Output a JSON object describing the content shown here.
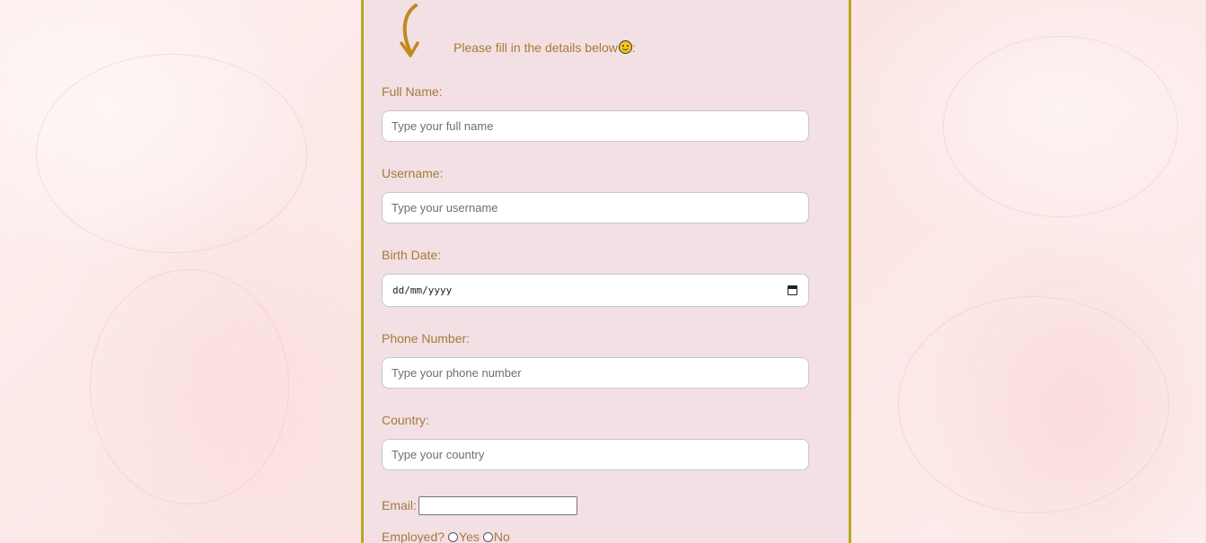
{
  "form": {
    "intro": "Please fill in the details below",
    "intro_suffix": ":",
    "fields": [
      {
        "label": "Full Name:",
        "placeholder": "Type your full name"
      },
      {
        "label": "Username:",
        "placeholder": "Type your username"
      },
      {
        "label": "Birth Date:",
        "value": "dd/mm/yyyy"
      },
      {
        "label": "Phone Number:",
        "placeholder": "Type your phone number"
      },
      {
        "label": "Country:",
        "placeholder": "Type your country"
      }
    ],
    "email_label": "Email:",
    "employed_label": "Employed?",
    "employed_options": [
      "Yes",
      "No"
    ]
  },
  "colors": {
    "label": "#a57b3a",
    "panel": "#f2e0e4",
    "border": "#b7a81d",
    "arrow": "#c08a1e"
  },
  "icons": [
    "arrow-down-icon",
    "smile-icon",
    "calendar-icon"
  ]
}
